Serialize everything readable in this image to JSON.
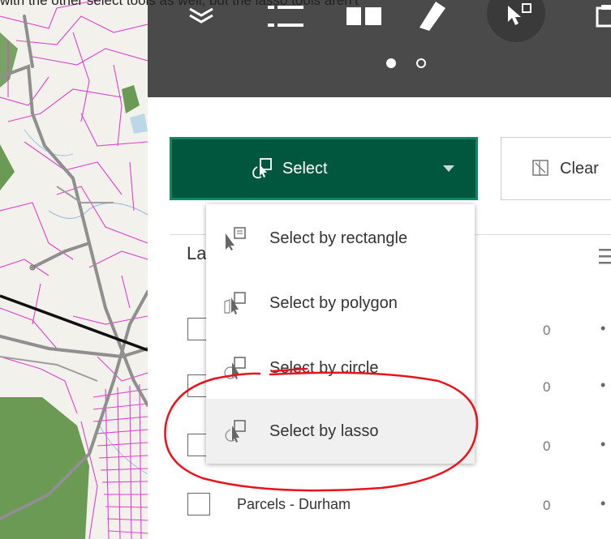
{
  "caption": "with the other select tools as well, but the lasso tools aren't",
  "header": {
    "toolbar_icons": [
      "layers-icon",
      "legend-list-icon",
      "basemap-gallery-icon",
      "measure-ruler-icon",
      "select-cursor-icon",
      "clipboard-icon"
    ],
    "page_dots": [
      "active",
      "inactive"
    ]
  },
  "select_button": {
    "label": "Select",
    "icon": "select-lasso-icon",
    "caret": "chevron-down-icon"
  },
  "clear_button": {
    "label": "Clear",
    "icon": "clear-selection-icon"
  },
  "layers_label": "La",
  "menu": {
    "items": [
      {
        "label": "Select by rectangle",
        "icon": "select-rectangle-icon"
      },
      {
        "label": "Select by polygon",
        "icon": "select-polygon-icon"
      },
      {
        "label": "Select by circle",
        "icon": "select-circle-icon"
      },
      {
        "label": "Select by lasso",
        "icon": "select-lasso-icon"
      }
    ]
  },
  "rows": [
    {
      "name": "",
      "count": "0"
    },
    {
      "name": "",
      "count": "0"
    },
    {
      "name": "",
      "count": "0"
    },
    {
      "name": "Parcels - Durham",
      "count": "0"
    }
  ],
  "colors": {
    "header_bg": "#4a4a4a",
    "select_bg": "#00573d",
    "select_border": "#0d8a5f",
    "parcel_lines": "#e040d0",
    "annotation": "#e8131b"
  }
}
